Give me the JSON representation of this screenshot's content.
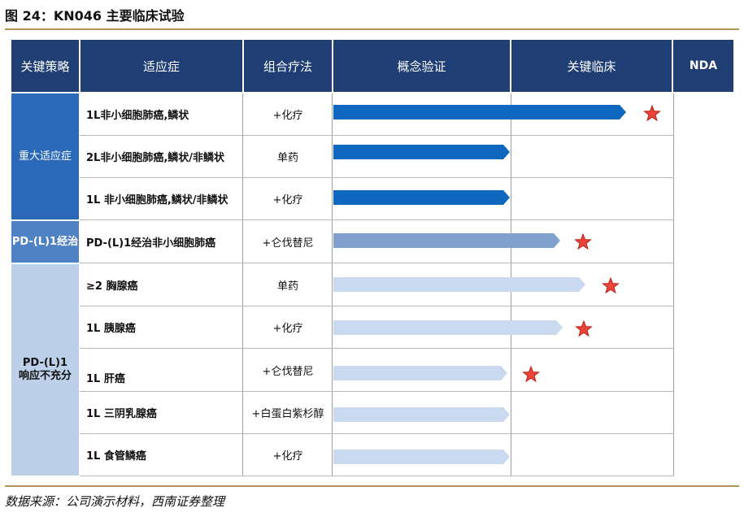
{
  "title": "图 24：KN046 主要临床试验",
  "source": "数据来源：公司演示材料，西南证券整理",
  "headers": {
    "strategy": "关键策略",
    "indication": "适应症",
    "combination": "组合疗法",
    "poc": "概念验证",
    "pivotal": "关键临床",
    "nda": "NDA"
  },
  "categories": [
    {
      "label": "重大适应症"
    },
    {
      "label": "PD-(L)1经治"
    },
    {
      "label": "PD-(L)1响应不充分"
    }
  ],
  "rows": [
    {
      "indication": "1L非小细胞肺癌,鳞状",
      "combination": "+化疗",
      "stage": "关键临床",
      "star": true
    },
    {
      "indication": "2L非小细胞肺癌,鳞状/非鳞状",
      "combination": "单药",
      "stage": "概念验证",
      "star": false
    },
    {
      "indication": "1L 非小细胞肺癌,鳞状/非鳞状",
      "combination": "+化疗",
      "stage": "概念验证",
      "star": false
    },
    {
      "indication": "PD-(L)1经治非小细胞肺癌",
      "combination": "+仑伐替尼",
      "stage": "关键临床",
      "star": true
    },
    {
      "indication": "≥2 胸腺癌",
      "combination": "单药",
      "stage": "关键临床",
      "star": true
    },
    {
      "indication": "1L 胰腺癌",
      "combination": "+化疗",
      "stage": "关键临床",
      "star": true
    },
    {
      "indication": "1L 肝癌",
      "combination": "+仑伐替尼",
      "stage": "概念验证",
      "star": true
    },
    {
      "indication": "1L 三阴乳腺癌",
      "combination": "+白蛋白紫杉醇",
      "stage": "概念验证",
      "star": false
    },
    {
      "indication": "1L 食管鳞癌",
      "combination": "+化疗",
      "stage": "概念验证",
      "star": false
    }
  ],
  "colors": {
    "header_bg": "#1f3e73",
    "bar_major": "#0f67c0",
    "bar_pdl1_treated": "#7f9fcc",
    "bar_pdl1_inadequate": "#c9daf0",
    "star_fill": "#e8463a",
    "star_stroke": "#c0201a",
    "gold_rule": "#b3935a"
  }
}
